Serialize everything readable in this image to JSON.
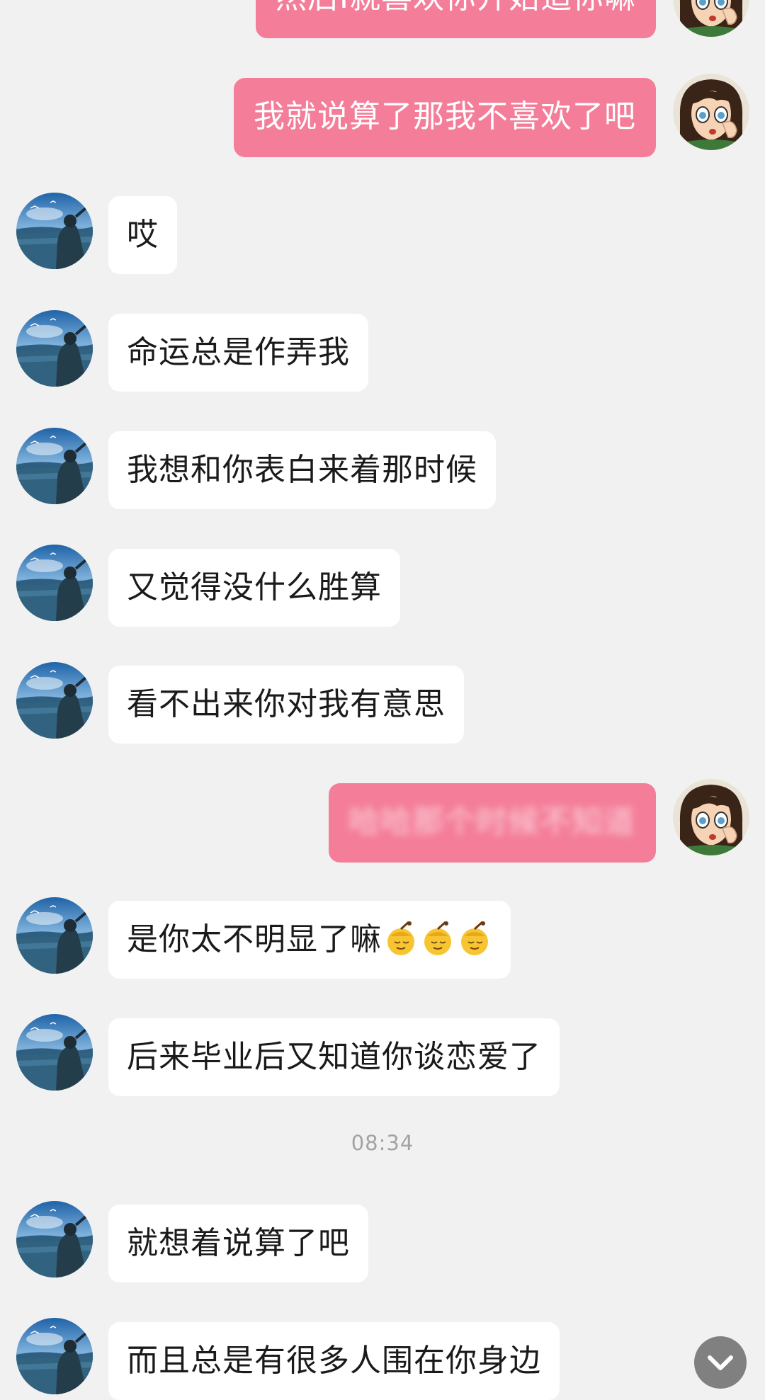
{
  "chat": {
    "messages": [
      {
        "from": "me",
        "text": "然后I就喜欢你开始追你嘛"
      },
      {
        "from": "me",
        "text": "我就说算了那我不喜欢了吧"
      },
      {
        "from": "friend",
        "text": "哎"
      },
      {
        "from": "friend",
        "text": "命运总是作弄我"
      },
      {
        "from": "friend",
        "text": "我想和你表白来着那时候"
      },
      {
        "from": "friend",
        "text": "又觉得没什么胜算"
      },
      {
        "from": "friend",
        "text": "看不出来你对我有意思"
      },
      {
        "from": "me",
        "text": "哈哈那个时候不知道"
      },
      {
        "from": "friend",
        "text": "是你太不明显了嘛",
        "emoji": [
          "sweat-smile-emoji",
          "sweat-smile-emoji",
          "sweat-smile-emoji"
        ]
      },
      {
        "from": "friend",
        "text": "后来毕业后又知道你谈恋爱了"
      },
      {
        "from": "friend",
        "text": "就想着说算了吧"
      },
      {
        "from": "friend",
        "text": "而且总是有很多人围在你身边"
      }
    ],
    "timestamp": "08:34"
  },
  "icons": {
    "friend_avatar": "landscape-photo-avatar",
    "my_avatar": "anime-girl-avatar",
    "scroll_down": "chevron-down-icon"
  },
  "colors": {
    "background": "#f1f1f1",
    "outgoing_bubble": "#f47e99",
    "incoming_bubble": "#ffffff"
  }
}
